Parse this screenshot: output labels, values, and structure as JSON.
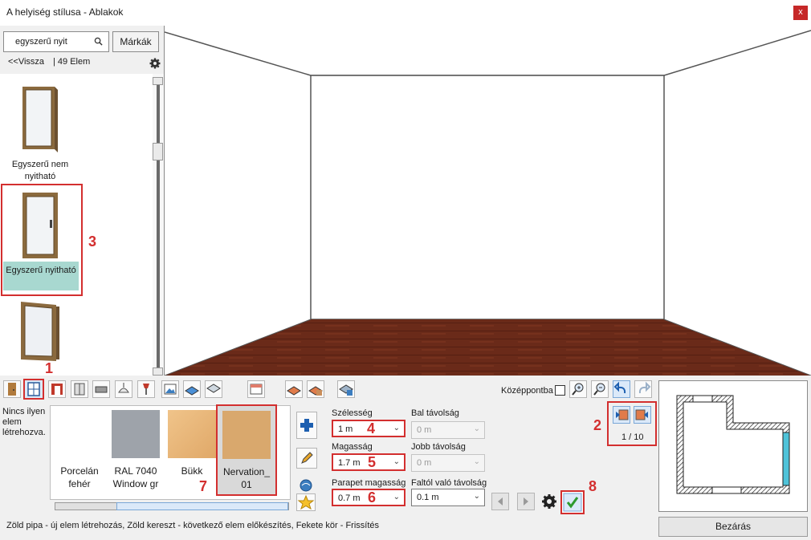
{
  "window": {
    "title": "A helyiség stílusa - Ablakok",
    "close_glyph": "x"
  },
  "search": {
    "value": "egyszerű nyit",
    "brands_label": "Márkák"
  },
  "nav": {
    "back_label": "<<Vissza",
    "count_label": "| 49 Elem"
  },
  "list_items": [
    {
      "label": "Egyszerű nem nyitható",
      "selected": false
    },
    {
      "label": "Egyszerű nyitható",
      "selected": true
    },
    {
      "label": "",
      "selected": false
    }
  ],
  "toolbar": {
    "center_label": "Középpontba"
  },
  "materials": {
    "empty_text": "Nincs ilyen elem létrehozva.",
    "items": [
      {
        "label": "Porcelán fehér",
        "color": "#ffffff"
      },
      {
        "label": "RAL 7040 Window gr",
        "color": "#9ea3aa"
      },
      {
        "label": "Bükk",
        "color": "#e9b77b"
      },
      {
        "label": "Nervation_ 01",
        "color": "#d9a86d"
      }
    ]
  },
  "fields": {
    "width": {
      "label": "Szélesség",
      "value": "1 m"
    },
    "height": {
      "label": "Magasság",
      "value": "1.7 m"
    },
    "sill": {
      "label": "Parapet magasság",
      "value": "0.7 m"
    },
    "left_dist": {
      "label": "Bal távolság",
      "value": "0 m"
    },
    "right_dist": {
      "label": "Jobb távolság",
      "value": "0 m"
    },
    "wall_dist": {
      "label": "Faltól való távolság",
      "value": "0.1 m"
    }
  },
  "pager": {
    "text": "1 / 10"
  },
  "callouts": [
    "1",
    "2",
    "3",
    "4",
    "5",
    "6",
    "7",
    "8"
  ],
  "status": "Zöld pipa - új elem létrehozás, Zöld kereszt - következő elem előkészítés, Fekete kör - Frissítés",
  "close_button": "Bezárás",
  "colors": {
    "accent_red": "#d32f2f",
    "selection": "#a8d8d0",
    "floor": "#6b2a1a"
  }
}
